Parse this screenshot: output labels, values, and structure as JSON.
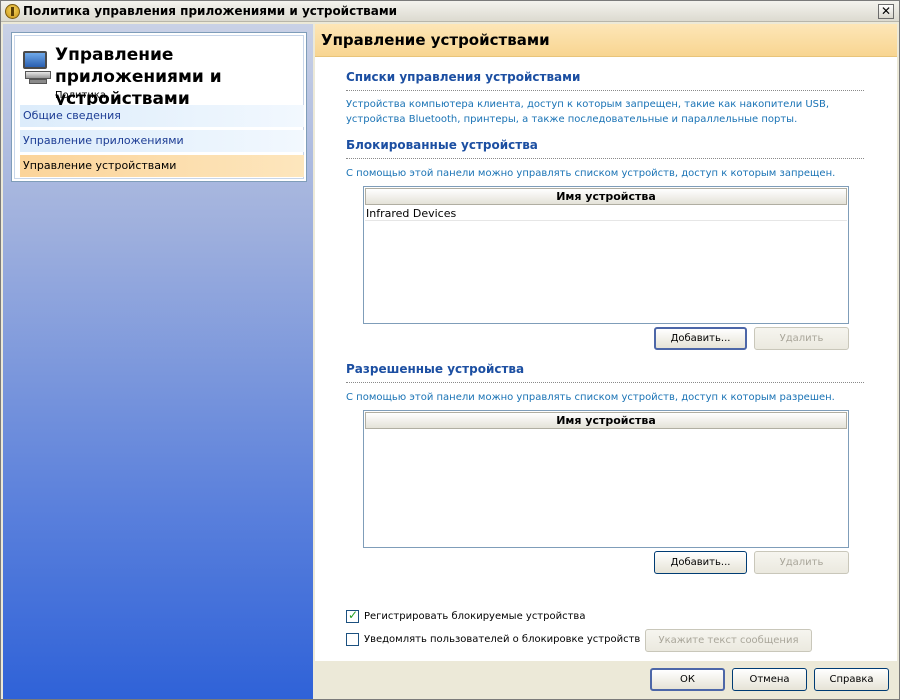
{
  "window": {
    "title": "Политика управления приложениями и устройствами",
    "close_glyph": "✕"
  },
  "nav": {
    "title": "Управление приложениями и устройствами",
    "subtitle": "Политика",
    "icon": "computer-icon",
    "items": [
      {
        "label": "Общие сведения",
        "active": false
      },
      {
        "label": "Управление приложениями",
        "active": false
      },
      {
        "label": "Управление устройствами",
        "active": true
      }
    ]
  },
  "header": {
    "title": "Управление устройствами"
  },
  "sections": {
    "lists": {
      "title": "Списки управления устройствами",
      "description": "Устройства компьютера клиента, доступ к которым запрещен, такие как накопители USB, устройства Bluetooth, принтеры, а также последовательные и параллельные порты."
    },
    "blocked": {
      "title": "Блокированные устройства",
      "description": "С помощью этой панели можно управлять списком устройств, доступ к которым запрещен.",
      "column_header": "Имя устройства",
      "rows": [
        "Infrared Devices"
      ],
      "add_label": "Добавить...",
      "remove_label": "Удалить"
    },
    "allowed": {
      "title": "Разрешенные устройства",
      "description": "С помощью этой панели можно управлять списком устройств, доступ к которым разрешен.",
      "column_header": "Имя устройства",
      "rows": [],
      "add_label": "Добавить...",
      "remove_label": "Удалить"
    }
  },
  "options": {
    "log_blocked": {
      "label": "Регистрировать блокируемые устройства",
      "checked": true
    },
    "notify_users": {
      "label": "Уведомлять пользователей о блокировке устройств",
      "checked": false
    },
    "message_button_label": "Укажите текст сообщения"
  },
  "footer": {
    "ok_label": "ОК",
    "cancel_label": "Отмена",
    "help_label": "Справка"
  },
  "colors": {
    "accent_header": "#f8d591",
    "section_title": "#1c4fa2",
    "description": "#1a73b5",
    "active_nav": "#fbd49a"
  }
}
